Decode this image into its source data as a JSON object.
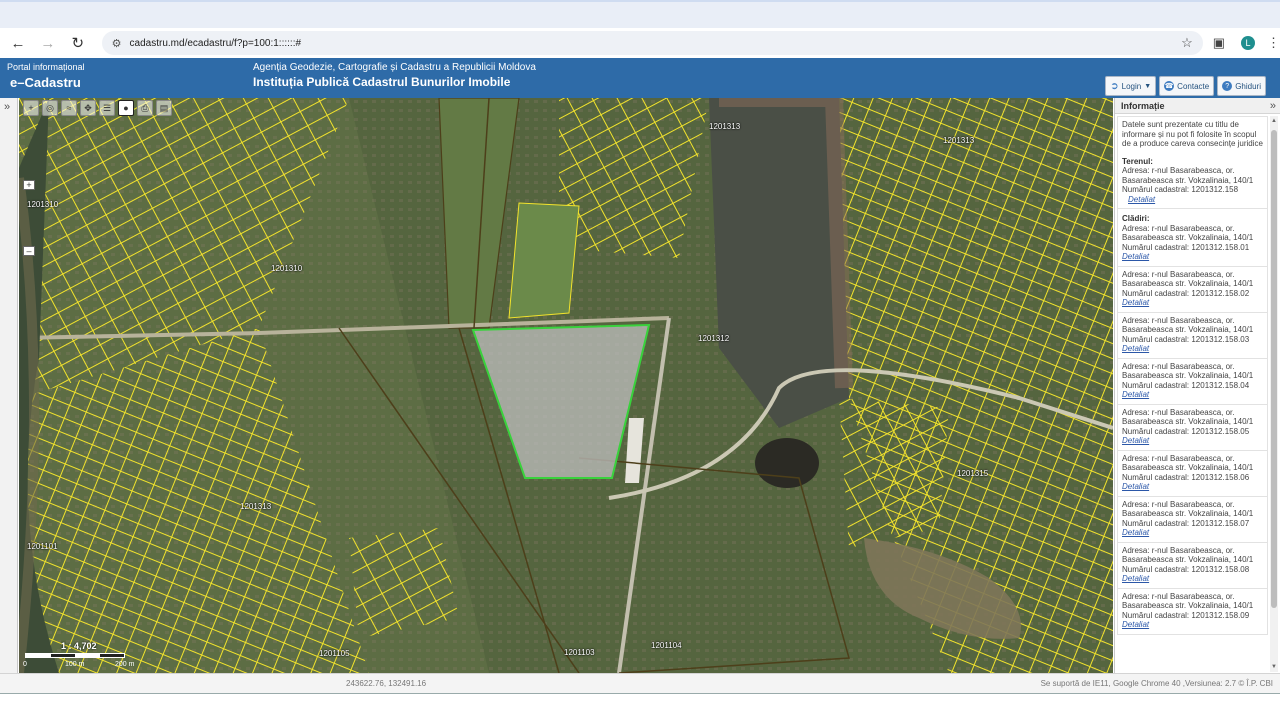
{
  "browser": {
    "url": "cadastru.md/ecadastru/f?p=100:1::::::#",
    "profile_initial": "L",
    "icons": {
      "back": "arrow-left-icon",
      "forward": "arrow-right-icon",
      "reload": "reload-icon",
      "site_info": "tune-icon",
      "bookmark": "star-icon",
      "extensions": "puzzle-icon",
      "menu": "kebab-icon"
    }
  },
  "header": {
    "portal_label": "Portal informațional",
    "app_name": "e–Cadastru",
    "agency": "Agenția Geodezie, Cartografie și Cadastru a Republicii Moldova",
    "institution": "Instituția Publică Cadastrul Bunurilor Imobile",
    "buttons": {
      "login": "Login",
      "contacts": "Contacte",
      "guides": "Ghiduri"
    },
    "colors": {
      "banner": "#2e6ba8",
      "link": "#2b57a8"
    }
  },
  "map": {
    "zoom_in": "+",
    "zoom_out": "–",
    "scale_ratio": "1 : 4,702",
    "scale_labels": [
      "0",
      "100 m",
      "200 m"
    ],
    "parcel_labels": [
      "1201310",
      "1201310",
      "1201313",
      "1201313",
      "1201312",
      "1201315",
      "1201313",
      "1201101",
      "1201105",
      "1201103",
      "1201104"
    ],
    "colors": {
      "parcel_outline": "#f2e32c",
      "selected_parcel": "#39d23c",
      "selected_fill": "#bfbfbf"
    }
  },
  "panel": {
    "title": "Informație",
    "disclaimer": "Datele sunt prezentate cu titlu de informare și nu pot fi folosite în scopul de a produce careva consecințe juridice",
    "land": {
      "heading": "Terenul:",
      "address": "Adresa: r-nul Basarabeasca, or. Basarabeasca str. Vokzalinaia, 140/1",
      "cadastral": "Numărul cadastral: 1201312.158",
      "details": "Detaliat"
    },
    "buildings_heading": "Clădiri:",
    "buildings": [
      {
        "address": "Adresa: r-nul Basarabeasca, or. Basarabeasca str. Vokzalinaia, 140/1",
        "cadastral": "Numărul cadastral: 1201312.158.01",
        "details": "Detaliat"
      },
      {
        "address": "Adresa: r-nul Basarabeasca, or. Basarabeasca str. Vokzalinaia, 140/1",
        "cadastral": "Numărul cadastral: 1201312.158.02",
        "details": "Detaliat"
      },
      {
        "address": "Adresa: r-nul Basarabeasca, or. Basarabeasca str. Vokzalinaia, 140/1",
        "cadastral": "Numărul cadastral: 1201312.158.03",
        "details": "Detaliat"
      },
      {
        "address": "Adresa: r-nul Basarabeasca, or. Basarabeasca str. Vokzalinaia, 140/1",
        "cadastral": "Numărul cadastral: 1201312.158.04",
        "details": "Detaliat"
      },
      {
        "address": "Adresa: r-nul Basarabeasca, or. Basarabeasca str. Vokzalinaia, 140/1",
        "cadastral": "Numărul cadastral: 1201312.158.05",
        "details": "Detaliat"
      },
      {
        "address": "Adresa: r-nul Basarabeasca, or. Basarabeasca str. Vokzalinaia, 140/1",
        "cadastral": "Numărul cadastral: 1201312.158.06",
        "details": "Detaliat"
      },
      {
        "address": "Adresa: r-nul Basarabeasca, or. Basarabeasca str. Vokzalinaia, 140/1",
        "cadastral": "Numărul cadastral: 1201312.158.07",
        "details": "Detaliat"
      },
      {
        "address": "Adresa: r-nul Basarabeasca, or. Basarabeasca str. Vokzalinaia, 140/1",
        "cadastral": "Numărul cadastral: 1201312.158.08",
        "details": "Detaliat"
      },
      {
        "address": "Adresa: r-nul Basarabeasca, or. Basarabeasca str. Vokzalinaia, 140/1",
        "cadastral": "Numărul cadastral: 1201312.158.09",
        "details": "Detaliat"
      }
    ]
  },
  "status": {
    "coordinates": "243622.76, 132491.16",
    "support": "Se suportă de IE11, Google Chrome 40 ,Versiunea: 2.7 © Î.P. CBI"
  }
}
